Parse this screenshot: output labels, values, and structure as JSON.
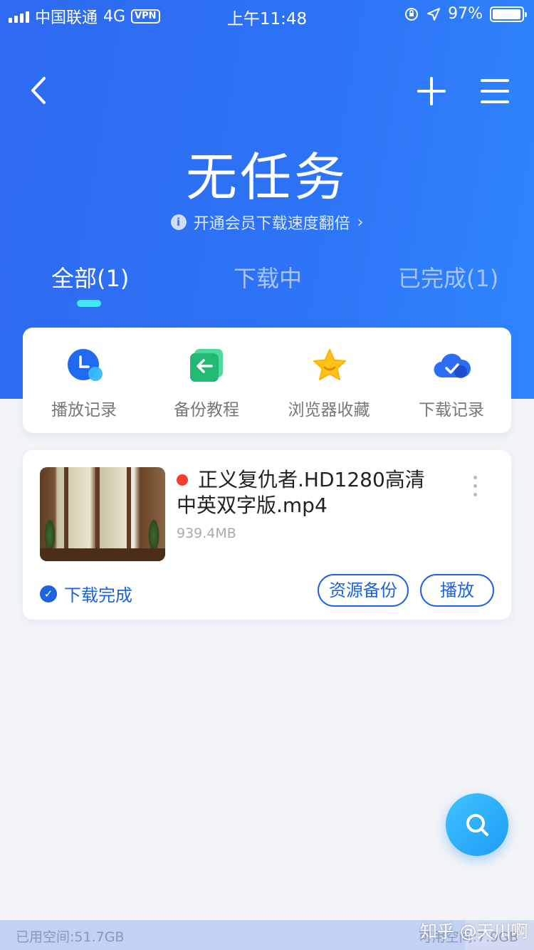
{
  "status_bar": {
    "carrier": "中国联通",
    "network": "4G",
    "vpn": "VPN",
    "time": "上午11:48",
    "battery_percent": "97%",
    "battery_level": 0.97
  },
  "header": {
    "title": "无任务",
    "vip_promo": "开通会员下载速度翻倍",
    "vip_arrow": "›",
    "info_icon": "i"
  },
  "tabs": [
    {
      "label": "全部(1)",
      "active": true
    },
    {
      "label": "下载中",
      "active": false
    },
    {
      "label": "已完成(1)",
      "active": false
    }
  ],
  "shortcuts": [
    {
      "label": "播放记录",
      "icon": "clock-icon",
      "color": "#1e6bf2"
    },
    {
      "label": "备份教程",
      "icon": "backup-icon",
      "color": "#2bc47a"
    },
    {
      "label": "浏览器收藏",
      "icon": "star-icon",
      "color": "#ffc21a"
    },
    {
      "label": "下载记录",
      "icon": "cloud-check-icon",
      "color": "#2a6ef5"
    }
  ],
  "task": {
    "file_name": "正义复仇者.HD1280高清中英双字版.mp4",
    "file_size": "939.4MB",
    "status": "下载完成",
    "backup_button": "资源备份",
    "play_button": "播放"
  },
  "storage": {
    "used": "已用空间:51.7GB",
    "available": "可用空间:7.9GB",
    "used_fraction": 0.87
  },
  "watermark": "知乎 @天川啊",
  "colors": {
    "header_blue": "#2f6af1",
    "accent_blue": "#1d62e0",
    "tab_indicator": "#41e6f5",
    "red_dot": "#f33d2f"
  }
}
